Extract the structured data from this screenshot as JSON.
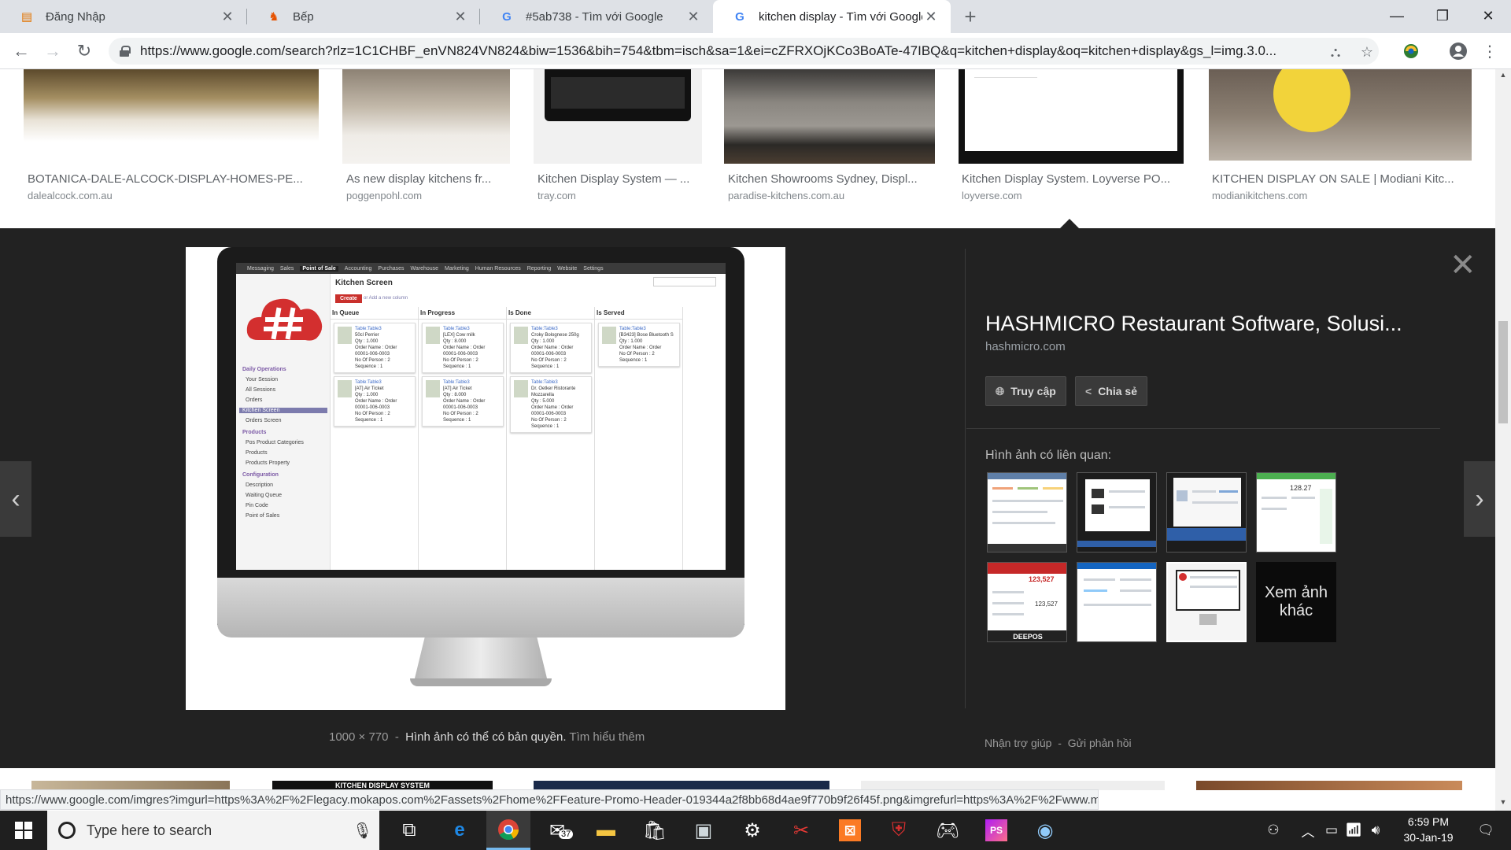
{
  "browser": {
    "tabs": [
      {
        "title": "Đăng Nhập",
        "active": false
      },
      {
        "title": "Bếp",
        "active": false
      },
      {
        "title": "#5ab738 - Tìm với Google",
        "active": false
      },
      {
        "title": "kitchen display - Tìm với Google",
        "active": true
      }
    ],
    "url": "https://www.google.com/search?rlz=1C1CHBF_enVN824VN824&biw=1536&bih=754&tbm=isch&sa=1&ei=cZFRXOjKCo3BoATe-47IBQ&q=kitchen+display&oq=kitchen+display&gs_l=img.3.0..."
  },
  "results_top": [
    {
      "caption": "BOTANICA-DALE-ALCOCK-DISPLAY-HOMES-PE...",
      "domain": "dalealcock.com.au"
    },
    {
      "caption": "As new display kitchens fr...",
      "domain": "poggenpohl.com"
    },
    {
      "caption": "Kitchen Display System — ...",
      "domain": "tray.com"
    },
    {
      "caption": "Kitchen Showrooms Sydney, Displ...",
      "domain": "paradise-kitchens.com.au"
    },
    {
      "caption": "Kitchen Display System. Loyverse PO...",
      "domain": "loyverse.com"
    },
    {
      "caption": "KITCHEN DISPLAY ON SALE | Modiani Kitc...",
      "domain": "modianikitchens.com"
    }
  ],
  "preview_screen": {
    "menu": [
      "Messaging",
      "Sales",
      "Point of Sale",
      "Accounting",
      "Purchases",
      "Warehouse",
      "Marketing",
      "Human Resources",
      "Reporting",
      "Website",
      "Settings"
    ],
    "menu_active": "Point of Sale",
    "title": "Kitchen Screen",
    "create": "Create",
    "add_column": "or Add a new column",
    "sidebar": [
      {
        "label": "Daily Operations",
        "kind": "h"
      },
      {
        "label": "Your Session",
        "kind": "m"
      },
      {
        "label": "All Sessions",
        "kind": "m"
      },
      {
        "label": "Orders",
        "kind": "m"
      },
      {
        "label": "Kitchen Screen",
        "kind": "sel"
      },
      {
        "label": "Orders Screen",
        "kind": "m"
      },
      {
        "label": "Products",
        "kind": "h"
      },
      {
        "label": "Pos Product Categories",
        "kind": "m"
      },
      {
        "label": "Products",
        "kind": "m"
      },
      {
        "label": "Products Property",
        "kind": "m"
      },
      {
        "label": "Configuration",
        "kind": "h"
      },
      {
        "label": "Description",
        "kind": "m"
      },
      {
        "label": "Waiting Queue",
        "kind": "m"
      },
      {
        "label": "Pin Code",
        "kind": "m"
      },
      {
        "label": "Point of Sales",
        "kind": "m"
      }
    ],
    "columns": [
      {
        "title": "In Queue",
        "cards": [
          {
            "table": "Table:Table3",
            "item": "50cl Perrier",
            "qty": "Qty : 1.000",
            "order": "Order Name : Order 00001-006-0003",
            "persons": "No Of Person : 2",
            "seq": "Sequence : 1"
          },
          {
            "table": "Table:Table3",
            "item": "[AT] Air Ticket",
            "qty": "Qty : 1.000",
            "order": "Order Name : Order 00001-006-0003",
            "persons": "No Of Person : 2",
            "seq": "Sequence : 1"
          }
        ]
      },
      {
        "title": "In Progress",
        "cards": [
          {
            "table": "Table:Table3",
            "item": "[LEX] Cow milk",
            "qty": "Qty : 8.000",
            "order": "Order Name : Order 00001-006-0003",
            "persons": "No Of Person : 2",
            "seq": "Sequence : 1"
          },
          {
            "table": "Table:Table3",
            "item": "[AT] Air Ticket",
            "qty": "Qty : 8.000",
            "order": "Order Name : Order 00001-006-0003",
            "persons": "No Of Person : 2",
            "seq": "Sequence : 1"
          }
        ]
      },
      {
        "title": "Is Done",
        "cards": [
          {
            "table": "Table:Table3",
            "item": "Croky Bolognese 250g",
            "qty": "Qty : 1.000",
            "order": "Order Name : Order 00001-006-0003",
            "persons": "No Of Person : 2",
            "seq": "Sequence : 1"
          },
          {
            "table": "Table:Table3",
            "item": "Dr. Oetker Ristorante Mozzarella",
            "qty": "Qty : 5.000",
            "order": "Order Name : Order 00001-006-0003",
            "persons": "No Of Person : 2",
            "seq": "Sequence : 1"
          }
        ]
      },
      {
        "title": "Is Served",
        "cards": [
          {
            "table": "Table:Table3",
            "item": "[B3423] Bose Bluetooth S",
            "qty": "Qty : 1.000",
            "order": "Order Name : Order",
            "persons": "No Of Person : 2",
            "seq": "Sequence : 1"
          }
        ]
      }
    ]
  },
  "details": {
    "title": "HASHMICRO Restaurant Software, Solusi...",
    "site": "hashmicro.com",
    "visit_label": "Truy cập",
    "share_label": "Chia sẻ",
    "related_label": "Hình ảnh có liên quan:",
    "more_label": "Xem ảnh khác",
    "related_thumb_text": {
      "t5_a": "123,527",
      "t5_b": "123,527",
      "t5_logo": "DEEPOS",
      "t4_a": "128.27"
    },
    "size_info": "1000 × 770",
    "copyright": "Hình ảnh có thể có bản quyền.",
    "learn_more": "Tìm hiểu thêm",
    "help": "Nhận trợ giúp",
    "feedback": "Gửi phản hồi"
  },
  "bottom_row": {
    "banner_text": "KITCHEN DISPLAY SYSTEM"
  },
  "status_url": "https://www.google.com/imgres?imgurl=https%3A%2F%2Flegacy.mokapos.com%2Fassets%2Fhome%2FFeature-Promo-Header-019344a2f8bb68d4ae9f770b9f26f45f.png&imgrefurl=https%3A%2F%2Fwww.mokapos.com%2Ffeatures&docid=IR1x42iJEOYpkM&tbnid=O1Gp2Wb_iUN8...",
  "taskbar": {
    "search_placeholder": "Type here to search",
    "mail_badge": "37",
    "time": "6:59 PM",
    "date": "30-Jan-19"
  },
  "colors": {
    "google_blue": "#4285f4",
    "hashmicro_red": "#d32f2f",
    "create_red": "#c9302c"
  }
}
